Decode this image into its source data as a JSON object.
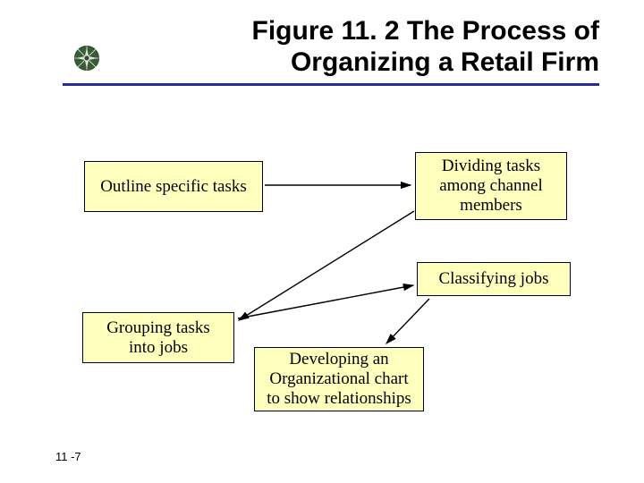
{
  "title_line1": "Figure 11. 2 The Process of",
  "title_line2": "Organizing a Retail Firm",
  "boxes": {
    "outline": "Outline specific tasks",
    "dividing": "Dividing tasks among channel members",
    "grouping": "Grouping tasks into jobs",
    "classifying": "Classifying jobs",
    "developing": "Developing an Organizational chart to show relationships"
  },
  "page_number": "11 -7",
  "logo_name": "compass-icon"
}
